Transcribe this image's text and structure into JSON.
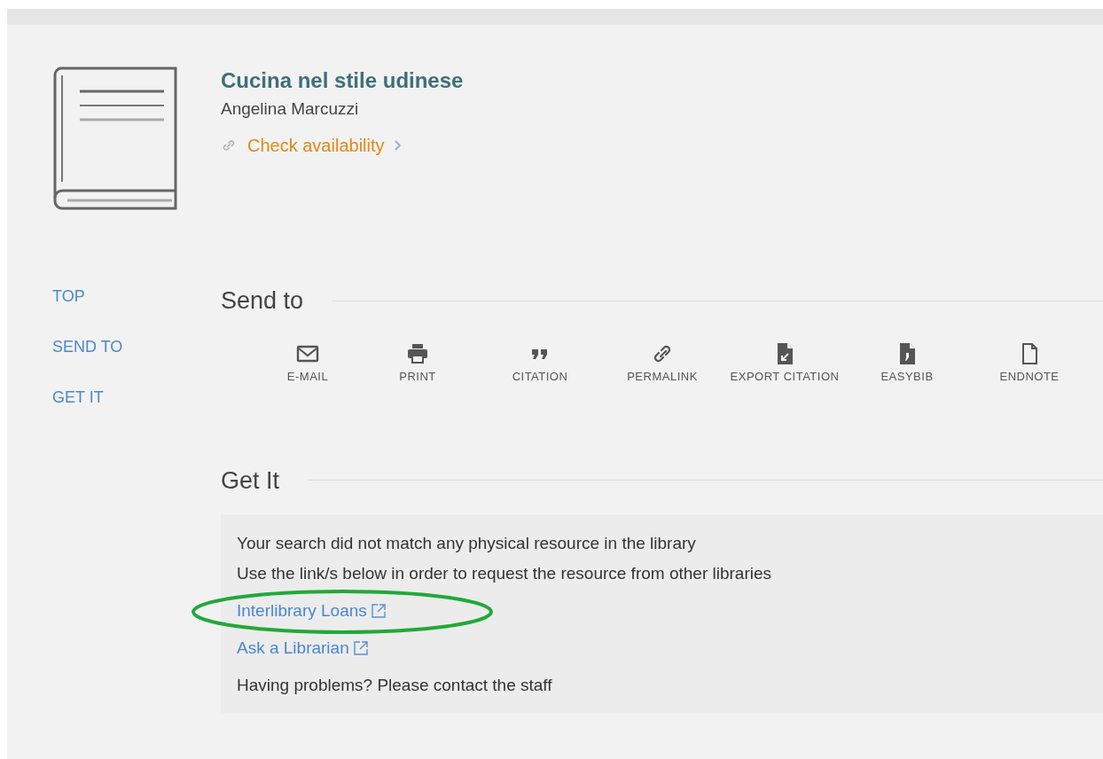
{
  "record": {
    "title": "Cucina nel stile udinese",
    "author": "Angelina Marcuzzi",
    "availability": "Check availability"
  },
  "nav": [
    {
      "label": "TOP"
    },
    {
      "label": "SEND TO"
    },
    {
      "label": "GET IT"
    }
  ],
  "send_to": {
    "heading": "Send to",
    "actions": [
      {
        "kind": "mail",
        "label": "E-MAIL"
      },
      {
        "kind": "print",
        "label": "PRINT"
      },
      {
        "kind": "quote",
        "label": "CITATION"
      },
      {
        "kind": "link",
        "label": "PERMALINK"
      },
      {
        "kind": "export",
        "label": "EXPORT CITATION"
      },
      {
        "kind": "comma",
        "label": "EASYBIB"
      },
      {
        "kind": "file",
        "label": "ENDNOTE"
      }
    ]
  },
  "get_it": {
    "heading": "Get It",
    "lines": [
      {
        "kind": "text",
        "text": "Your search did not match any physical resource in the library"
      },
      {
        "kind": "text",
        "text": "Use the link/s below in order to request the resource from other libraries"
      },
      {
        "kind": "link",
        "text": "Interlibrary Loans",
        "circled": true
      },
      {
        "kind": "link",
        "text": "Ask a Librarian",
        "circled": false
      },
      {
        "kind": "text",
        "text": "Having problems? Please contact the staff"
      }
    ]
  }
}
